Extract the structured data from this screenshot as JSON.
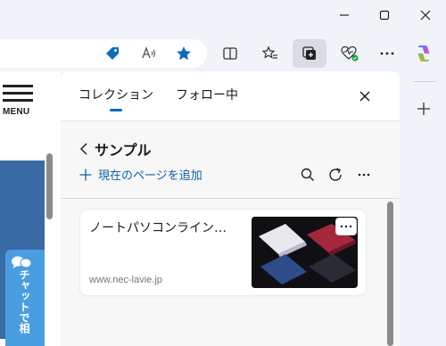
{
  "window": {
    "minimize_icon": "minimize-icon",
    "maximize_icon": "maximize-icon",
    "close_icon": "close-icon"
  },
  "toolbar": {
    "icons": [
      "tag-icon",
      "read-aloud-icon",
      "favorite-star-icon",
      "split-screen-icon",
      "favorites-icon",
      "collections-icon",
      "browser-health-icon",
      "more-icon",
      "copilot-icon"
    ],
    "accent": "#0f6cbd"
  },
  "webpage": {
    "menu_label": "MENU",
    "chat_label": "チャットで相"
  },
  "collections": {
    "tabs": [
      {
        "label": "コレクション",
        "active": true
      },
      {
        "label": "フォロー中",
        "active": false
      }
    ],
    "collection_title": "サンプル",
    "add_page_label": "現在のページを追加",
    "items": [
      {
        "title": "ノートパソコンライン…",
        "url": "www.nec-lavie.jp",
        "thumbnail_icon": "laptop-thumbnail"
      }
    ]
  },
  "sidebar": {
    "add_icon": "add-icon"
  }
}
